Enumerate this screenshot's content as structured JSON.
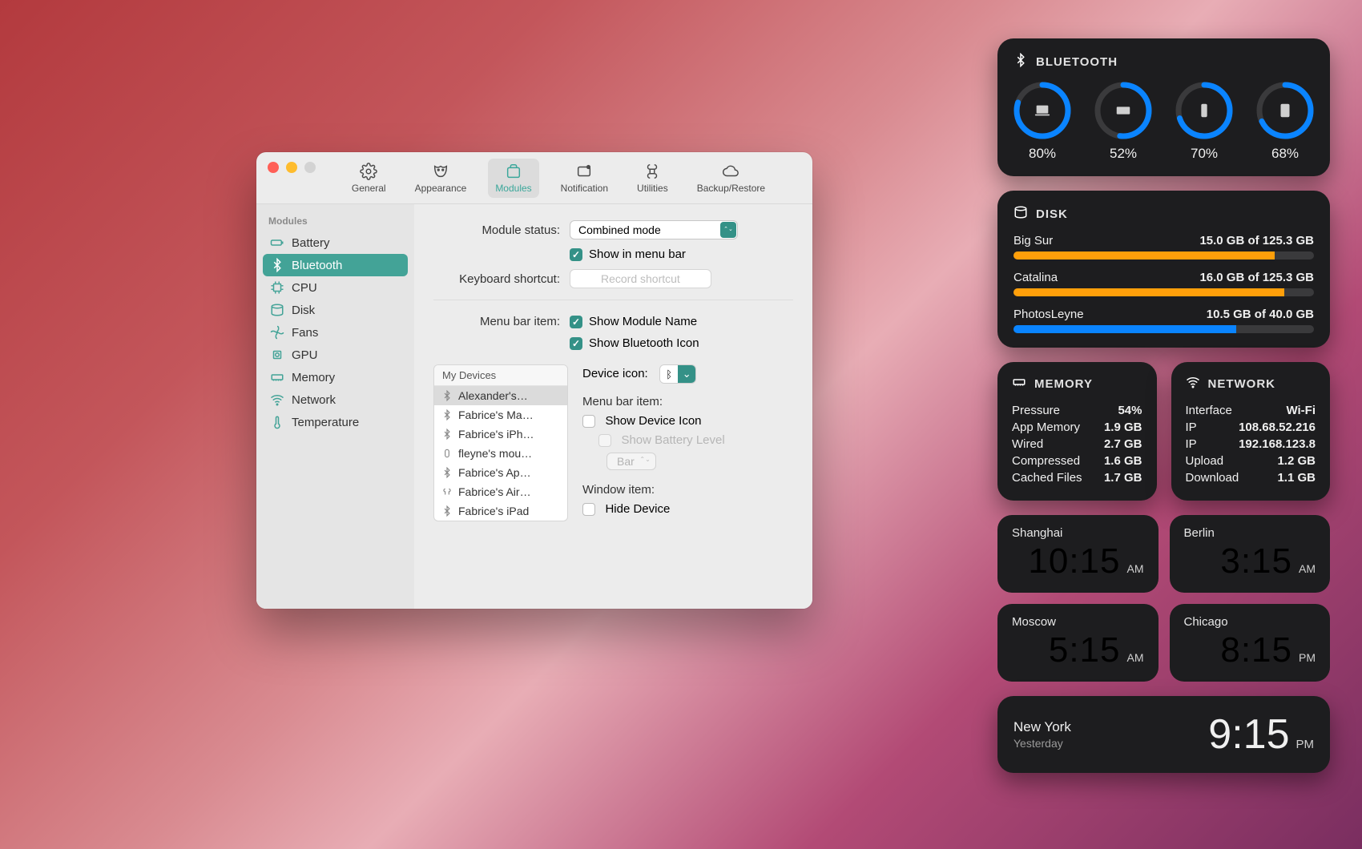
{
  "prefs": {
    "toolbar": {
      "general": "General",
      "appearance": "Appearance",
      "modules": "Modules",
      "notification": "Notification",
      "utilities": "Utilities",
      "backup": "Backup/Restore"
    },
    "sidebar": {
      "header": "Modules",
      "items": [
        {
          "label": "Battery"
        },
        {
          "label": "Bluetooth"
        },
        {
          "label": "CPU"
        },
        {
          "label": "Disk"
        },
        {
          "label": "Fans"
        },
        {
          "label": "GPU"
        },
        {
          "label": "Memory"
        },
        {
          "label": "Network"
        },
        {
          "label": "Temperature"
        }
      ]
    },
    "pane": {
      "module_status_label": "Module status:",
      "module_status_value": "Combined mode",
      "show_in_menu_bar": "Show in menu bar",
      "keyboard_shortcut_label": "Keyboard shortcut:",
      "record_shortcut": "Record shortcut",
      "menu_bar_item_label": "Menu bar item:",
      "show_module_name": "Show Module Name",
      "show_bluetooth_icon": "Show Bluetooth Icon",
      "devices_header": "My Devices",
      "devices": [
        "Alexander's…",
        "Fabrice's Ma…",
        "Fabrice's iPh…",
        "fleyne's mou…",
        "Fabrice's Ap…",
        "Fabrice's Air…",
        "Fabrice's iPad"
      ],
      "device_icon_label": "Device icon:",
      "menu_bar_item2": "Menu bar item:",
      "show_device_icon": "Show Device Icon",
      "show_battery_level": "Show Battery Level",
      "bar": "Bar",
      "window_item_label": "Window item:",
      "hide_device": "Hide Device"
    }
  },
  "widgets": {
    "bluetooth": {
      "title": "BLUETOOTH",
      "devices": [
        {
          "pct": 80,
          "label": "80%",
          "icon": "laptop"
        },
        {
          "pct": 52,
          "label": "52%",
          "icon": "keyboard"
        },
        {
          "pct": 70,
          "label": "70%",
          "icon": "phone"
        },
        {
          "pct": 68,
          "label": "68%",
          "icon": "tablet"
        }
      ]
    },
    "disk": {
      "title": "DISK",
      "volumes": [
        {
          "name": "Big Sur",
          "used": "15.0 GB of 125.3 GB",
          "pct": 87,
          "color": "#ff9f0a"
        },
        {
          "name": "Catalina",
          "used": "16.0 GB of 125.3 GB",
          "pct": 90,
          "color": "#ff9f0a"
        },
        {
          "name": "PhotosLeyne",
          "used": "10.5 GB of 40.0 GB",
          "pct": 74,
          "color": "#0a84ff"
        }
      ]
    },
    "memory": {
      "title": "MEMORY",
      "rows": [
        {
          "k": "Pressure",
          "v": "54%"
        },
        {
          "k": "App Memory",
          "v": "1.9 GB"
        },
        {
          "k": "Wired",
          "v": "2.7 GB"
        },
        {
          "k": "Compressed",
          "v": "1.6 GB"
        },
        {
          "k": "Cached Files",
          "v": "1.7 GB"
        }
      ]
    },
    "network": {
      "title": "NETWORK",
      "rows": [
        {
          "k": "Interface",
          "v": "Wi-Fi"
        },
        {
          "k": "IP",
          "v": "108.68.52.216"
        },
        {
          "k": "IP",
          "v": "192.168.123.8"
        },
        {
          "k": "Upload",
          "v": "1.2 GB"
        },
        {
          "k": "Download",
          "v": "1.1 GB"
        }
      ]
    },
    "clocks": {
      "cells": [
        {
          "city": "Shanghai",
          "time": "10:15",
          "ampm": "AM"
        },
        {
          "city": "Berlin",
          "time": "3:15",
          "ampm": "AM"
        },
        {
          "city": "Moscow",
          "time": "5:15",
          "ampm": "AM"
        },
        {
          "city": "Chicago",
          "time": "8:15",
          "ampm": "PM"
        }
      ]
    },
    "ny": {
      "city": "New York",
      "sub": "Yesterday",
      "time": "9:15",
      "ampm": "PM"
    }
  }
}
